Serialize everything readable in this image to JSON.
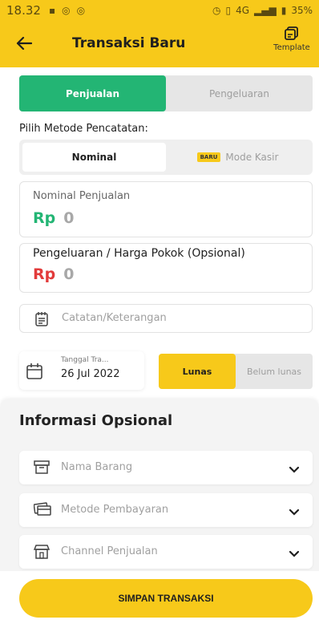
{
  "status_bar": {
    "time": "18.32",
    "network": "4G",
    "battery": "35%"
  },
  "appbar": {
    "title": "Transaksi Baru",
    "template_label": "Template"
  },
  "tabs": [
    {
      "label": "Penjualan",
      "active": true
    },
    {
      "label": "Pengeluaran",
      "active": false
    }
  ],
  "metode": {
    "label": "Pilih Metode Pencatatan:",
    "options": [
      {
        "label": "Nominal",
        "active": true
      },
      {
        "badge": "BARU",
        "label": "Mode Kasir",
        "active": false
      }
    ]
  },
  "nominal_penjualan": {
    "label": "Nominal Penjualan",
    "currency": "Rp",
    "value": "0"
  },
  "harga_pokok": {
    "label": "Pengeluaran / Harga Pokok (Opsional)",
    "currency": "Rp",
    "value": "0"
  },
  "catatan": {
    "placeholder": "Catatan/Keterangan"
  },
  "tanggal": {
    "label": "Tanggal Tra...",
    "value": "26 Jul 2022"
  },
  "status_pembayaran": [
    {
      "label": "Lunas",
      "active": true
    },
    {
      "label": "Belum lunas",
      "active": false
    }
  ],
  "informasi_opsional": {
    "heading": "Informasi Opsional",
    "rows": [
      {
        "label": "Nama Barang",
        "icon": "box-icon"
      },
      {
        "label": "Metode Pembayaran",
        "icon": "card-icon"
      },
      {
        "label": "Channel Penjualan",
        "icon": "store-icon"
      }
    ]
  },
  "save_button": "SIMPAN TRANSAKSI",
  "colors": {
    "brand_yellow": "#f7c91a",
    "green": "#23b574",
    "red": "#e23b3b"
  }
}
